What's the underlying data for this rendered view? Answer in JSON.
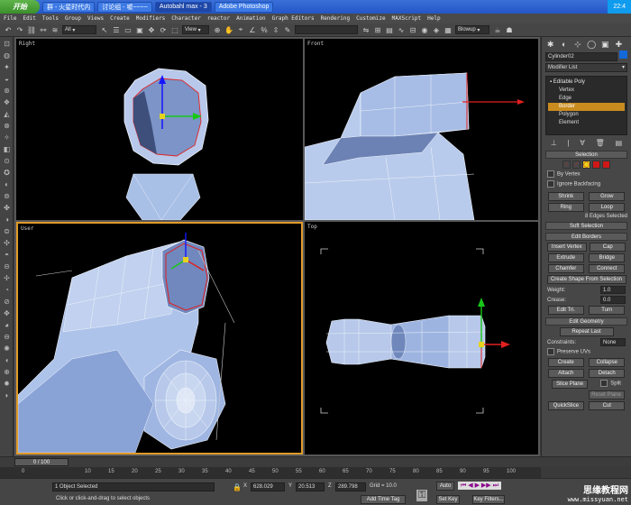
{
  "taskbar": {
    "start": "开始",
    "tasks": [
      {
        "label": "群 - 火星时代内",
        "active": false
      },
      {
        "label": "讨论组 - 嘘~~~~",
        "active": false
      },
      {
        "label": "Autobahl max - 3",
        "active": true
      },
      {
        "label": "Adobe Photoshop",
        "active": false
      }
    ],
    "clock": "22:4"
  },
  "menu": [
    "File",
    "Edit",
    "Tools",
    "Group",
    "Views",
    "Create",
    "Modifiers",
    "Character",
    "reactor",
    "Animation",
    "Graph Editors",
    "Rendering",
    "Customize",
    "MAXScript",
    "Help"
  ],
  "toolbar": {
    "filter": "All",
    "refcoord": "View",
    "render_preset": "Blowup"
  },
  "viewports": {
    "right": "Right",
    "front": "Front",
    "user": "User",
    "top": "Top"
  },
  "command_panel": {
    "object_name": "Cylinder02",
    "object_color": "#1468d8",
    "modifier_list": "Modifier List",
    "stack": {
      "root": "Editable Poly",
      "subs": [
        "Vertex",
        "Edge",
        "Border",
        "Polygon",
        "Element"
      ],
      "selected": "Border"
    },
    "selection": {
      "title": "Selection",
      "by_vertex": "By Vertex",
      "ignore_backfacing": "Ignore Backfacing",
      "shrink": "Shrink",
      "grow": "Grow",
      "ring": "Ring",
      "loop": "Loop",
      "info": "8 Edges Selected"
    },
    "soft_selection": "Soft Selection",
    "edit_borders": {
      "title": "Edit Borders",
      "insert_vertex": "Insert Vertex",
      "cap": "Cap",
      "extrude": "Extrude",
      "bridge": "Bridge",
      "chamfer": "Chamfer",
      "connect": "Connect",
      "create_shape": "Create Shape From Selection",
      "weight_label": "Weight:",
      "weight_value": "1.0",
      "crease_label": "Crease:",
      "crease_value": "0.0",
      "edit_tris": "Edit Tri.",
      "turn": "Turn"
    },
    "edit_geometry": {
      "title": "Edit Geometry",
      "repeat_last": "Repeat Last",
      "constraints_label": "Constraints:",
      "constraints_value": "None",
      "preserve_uvs": "Preserve UVs",
      "create": "Create",
      "collapse": "Collapse",
      "attach": "Attach",
      "detach": "Detach",
      "slice_plane": "Slice Plane",
      "split": "Split",
      "reset_plane": "Reset Plane",
      "quickslice": "QuickSlice",
      "cut": "Cut"
    }
  },
  "timeline": {
    "slider": "0 / 100",
    "ticks": [
      "0",
      "10",
      "15",
      "20",
      "25",
      "30",
      "35",
      "40",
      "45",
      "50",
      "55",
      "60",
      "65",
      "70",
      "75",
      "80",
      "85",
      "90",
      "95",
      "100"
    ]
  },
  "status": {
    "selected": "1 Object Selected",
    "prompt": "Click or click-and-drag to select objects",
    "x_label": "X",
    "x_value": "628.029",
    "y_label": "Y",
    "y_value": "20.513",
    "z_label": "Z",
    "z_value": "289.798",
    "grid": "Grid = 10.0",
    "add_time_tag": "Add Time Tag",
    "auto_key": "Auto",
    "set_key": "Set Key",
    "key_filters": "Key Filters..."
  },
  "watermark": {
    "line1": "思缘教程网",
    "line2": "www.missyuan.net"
  }
}
